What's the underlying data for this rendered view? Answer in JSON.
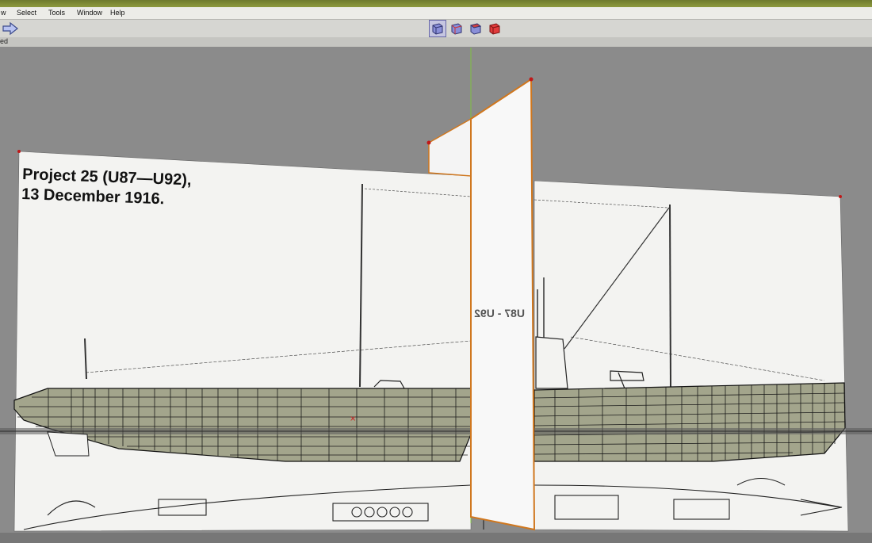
{
  "menu": {
    "view_fragment": "w",
    "select": "Select",
    "tools": "Tools",
    "window": "Window",
    "help": "Help"
  },
  "status": {
    "text": "ed"
  },
  "toolbar": {
    "view_buttons": [
      "front-view-icon",
      "side-view-icon",
      "top-view-icon",
      "perspective-view-icon"
    ]
  },
  "blueprint": {
    "title_line1": "Project 25 (U87—U92),",
    "title_line2": "13 December 1916."
  },
  "section_plane": {
    "label": "U87 - U92"
  },
  "colors": {
    "hull_fill": "#a3a58c",
    "plane_edge": "#d0771e",
    "axis_green": "#7fc241",
    "viewport_bg": "#8b8b8b",
    "title_strip": "#7d8a36"
  }
}
